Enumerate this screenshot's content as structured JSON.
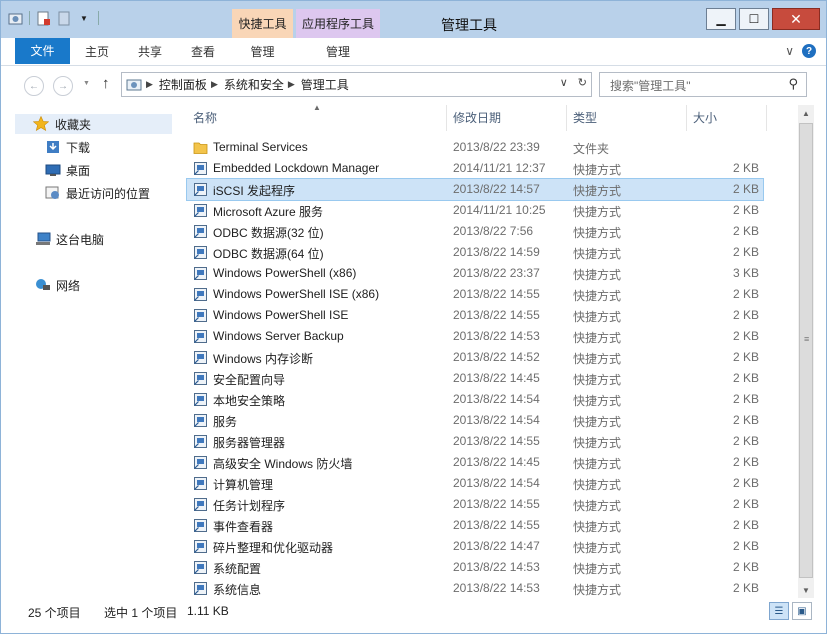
{
  "window": {
    "title": "管理工具",
    "context_tabs": [
      "快捷工具",
      "应用程序工具"
    ],
    "controls": {
      "minimize": "▁",
      "maximize": "☐",
      "close": "✕"
    }
  },
  "ribbon": {
    "tabs": [
      "文件",
      "主页",
      "共享",
      "查看",
      "管理",
      "管理"
    ],
    "expand_glyph": "∨",
    "help_glyph": "?"
  },
  "address": {
    "crumbs": [
      "控制面板",
      "系统和安全",
      "管理工具"
    ],
    "search_placeholder": "搜索\"管理工具\""
  },
  "nav": {
    "favorites": "收藏夹",
    "favorites_items": [
      "下载",
      "桌面",
      "最近访问的位置"
    ],
    "this_pc": "这台电脑",
    "network": "网络"
  },
  "columns": [
    "名称",
    "修改日期",
    "类型",
    "大小"
  ],
  "files": [
    {
      "name": "Terminal Services",
      "date": "2013/8/22 23:39",
      "type": "文件夹",
      "size": "",
      "icon": "folder-icon"
    },
    {
      "name": "Embedded Lockdown Manager",
      "date": "2014/11/21 12:37",
      "type": "快捷方式",
      "size": "2 KB",
      "icon": "lockdown-icon"
    },
    {
      "name": "iSCSI 发起程序",
      "date": "2013/8/22 14:57",
      "type": "快捷方式",
      "size": "2 KB",
      "icon": "iscsi-icon"
    },
    {
      "name": "Microsoft Azure 服务",
      "date": "2014/11/21 10:25",
      "type": "快捷方式",
      "size": "2 KB",
      "icon": "azure-icon"
    },
    {
      "name": "ODBC 数据源(32 位)",
      "date": "2013/8/22 7:56",
      "type": "快捷方式",
      "size": "2 KB",
      "icon": "odbc-icon"
    },
    {
      "name": "ODBC 数据源(64 位)",
      "date": "2013/8/22 14:59",
      "type": "快捷方式",
      "size": "2 KB",
      "icon": "odbc-icon"
    },
    {
      "name": "Windows PowerShell (x86)",
      "date": "2013/8/22 23:37",
      "type": "快捷方式",
      "size": "3 KB",
      "icon": "powershell-icon"
    },
    {
      "name": "Windows PowerShell ISE (x86)",
      "date": "2013/8/22 14:55",
      "type": "快捷方式",
      "size": "2 KB",
      "icon": "powershell-icon"
    },
    {
      "name": "Windows PowerShell ISE",
      "date": "2013/8/22 14:55",
      "type": "快捷方式",
      "size": "2 KB",
      "icon": "powershell-icon"
    },
    {
      "name": "Windows Server Backup",
      "date": "2013/8/22 14:53",
      "type": "快捷方式",
      "size": "2 KB",
      "icon": "backup-icon"
    },
    {
      "name": "Windows 内存诊断",
      "date": "2013/8/22 14:52",
      "type": "快捷方式",
      "size": "2 KB",
      "icon": "memory-icon"
    },
    {
      "name": "安全配置向导",
      "date": "2013/8/22 14:45",
      "type": "快捷方式",
      "size": "2 KB",
      "icon": "security-wizard-icon"
    },
    {
      "name": "本地安全策略",
      "date": "2013/8/22 14:54",
      "type": "快捷方式",
      "size": "2 KB",
      "icon": "policy-icon"
    },
    {
      "name": "服务",
      "date": "2013/8/22 14:54",
      "type": "快捷方式",
      "size": "2 KB",
      "icon": "services-icon"
    },
    {
      "name": "服务器管理器",
      "date": "2013/8/22 14:55",
      "type": "快捷方式",
      "size": "2 KB",
      "icon": "server-manager-icon"
    },
    {
      "name": "高级安全 Windows 防火墙",
      "date": "2013/8/22 14:45",
      "type": "快捷方式",
      "size": "2 KB",
      "icon": "firewall-icon"
    },
    {
      "name": "计算机管理",
      "date": "2013/8/22 14:54",
      "type": "快捷方式",
      "size": "2 KB",
      "icon": "computer-management-icon"
    },
    {
      "name": "任务计划程序",
      "date": "2013/8/22 14:55",
      "type": "快捷方式",
      "size": "2 KB",
      "icon": "task-scheduler-icon"
    },
    {
      "name": "事件查看器",
      "date": "2013/8/22 14:55",
      "type": "快捷方式",
      "size": "2 KB",
      "icon": "event-viewer-icon"
    },
    {
      "name": "碎片整理和优化驱动器",
      "date": "2013/8/22 14:47",
      "type": "快捷方式",
      "size": "2 KB",
      "icon": "defrag-icon"
    },
    {
      "name": "系统配置",
      "date": "2013/8/22 14:53",
      "type": "快捷方式",
      "size": "2 KB",
      "icon": "msconfig-icon"
    },
    {
      "name": "系统信息",
      "date": "2013/8/22 14:53",
      "type": "快捷方式",
      "size": "2 KB",
      "icon": "sysinfo-icon"
    }
  ],
  "selected_index": 2,
  "status": {
    "count": "25 个项目",
    "selection": "选中 1 个项目",
    "selection_size": "1.11 KB"
  },
  "colors": {
    "accent": "#1979ca",
    "titlebar": "#b9d1ea",
    "selection": "#cde3f7"
  }
}
